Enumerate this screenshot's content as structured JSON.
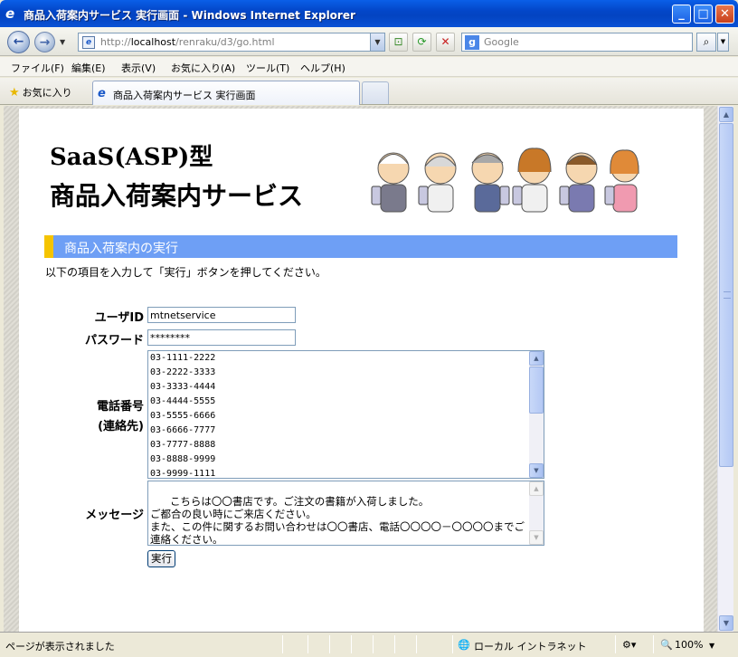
{
  "window": {
    "title": "商品入荷案内サービス 実行画面 - Windows Internet Explorer"
  },
  "address_bar": {
    "url_prefix": "http://",
    "url_host": "localhost",
    "url_path": "/renraku/d3/go.html",
    "search_placeholder": "Google"
  },
  "menu": [
    "ファイル(F)",
    "編集(E)",
    "表示(V)",
    "お気に入り(A)",
    "ツール(T)",
    "ヘルプ(H)"
  ],
  "favorites_label": "お気に入り",
  "tab": {
    "label": "商品入荷案内サービス 実行画面"
  },
  "page": {
    "logo_line1": "SaaS(ASP)型",
    "logo_line2": "商品入荷案内サービス",
    "section_title": "商品入荷案内の実行",
    "instruction": "以下の項目を入力して「実行」ボタンを押してください。",
    "form": {
      "user_id_label": "ユーザID",
      "user_id_value": "mtnetservice",
      "password_label": "パスワード",
      "password_value": "********",
      "phone_label_line1": "電話番号",
      "phone_label_line2": "(連絡先)",
      "phone_numbers": [
        "03-1111-2222",
        "03-2222-3333",
        "03-3333-4444",
        "03-4444-5555",
        "03-5555-6666",
        "03-6666-7777",
        "03-7777-8888",
        "03-8888-9999",
        "03-9999-1111"
      ],
      "message_label": "メッセージ",
      "message_value": "こちらは〇〇書店です。ご注文の書籍が入荷しました。\nご都合の良い時にご来店ください。\nまた、この件に関するお問い合わせは〇〇書店、電話〇〇〇〇－〇〇〇〇までご連絡ください。",
      "submit_label": "実行"
    }
  },
  "status": {
    "text": "ページが表示されました",
    "zone": "ローカル イントラネット",
    "zoom": "100%"
  },
  "colors": {
    "section_bar": "#6e9ff5",
    "section_accent": "#f5c400",
    "titlebar": "#0346c8"
  }
}
